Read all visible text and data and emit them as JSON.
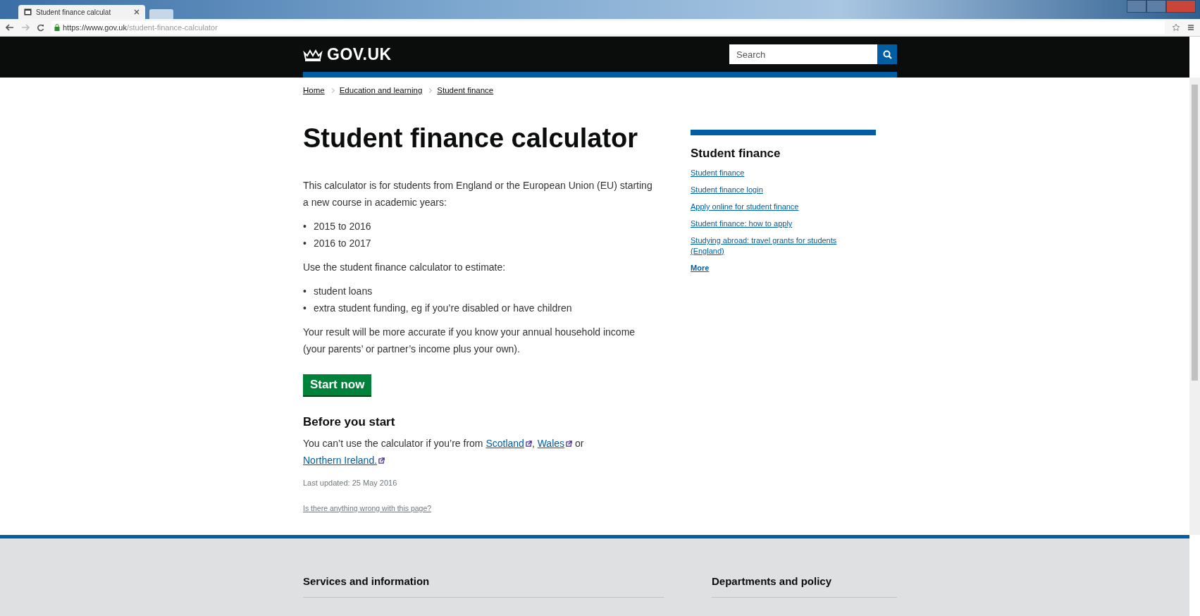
{
  "browser": {
    "tab_title": "Student finance calculat",
    "url_host": "https://www.gov.uk",
    "url_path": "/student-finance-calculator"
  },
  "header": {
    "logo": "GOV.UK",
    "search": {
      "placeholder": "Search"
    }
  },
  "breadcrumbs": [
    "Home",
    "Education and learning",
    "Student finance"
  ],
  "main": {
    "title": "Student finance calculator",
    "blocks": [
      {
        "kind": "para",
        "text": "This calculator is for students from England or the European Union (EU) starting a new course in academic years:"
      },
      {
        "kind": "list",
        "items": [
          {
            "marker": "•",
            "text": "2015 to 2016"
          },
          {
            "marker": "•",
            "text": "2016 to 2017"
          }
        ]
      },
      {
        "kind": "para",
        "text": "Use the student finance calculator to estimate:"
      },
      {
        "kind": "list",
        "items": [
          {
            "marker": "•",
            "text": "student loans"
          },
          {
            "marker": "•",
            "text": "extra student funding, eg if you’re disabled or have children"
          }
        ]
      },
      {
        "kind": "para",
        "text": "Your result will be more accurate if you know your annual household income (your parents’ or partner’s income plus your own)."
      }
    ],
    "start_button": "Start now",
    "before_heading": "Before you start",
    "before_parts": [
      {
        "kind": "text",
        "text": "You can’t use the calculator if you’re from "
      },
      {
        "kind": "link",
        "text": "Scotland"
      },
      {
        "kind": "text",
        "text": ", "
      },
      {
        "kind": "link",
        "text": "Wales"
      },
      {
        "kind": "text",
        "text": " or "
      },
      {
        "kind": "link",
        "text": "Northern Ireland."
      }
    ],
    "last_updated": "Last updated: 25 May 2016",
    "report_link": "Is there anything wrong with this page?"
  },
  "sidebar": {
    "title": "Student finance",
    "links": [
      "Student finance",
      "Student finance login",
      "Apply online for student finance",
      "Student finance: how to apply",
      "Studying abroad: travel grants for students (England)"
    ],
    "more": "More"
  },
  "footer": {
    "headings": [
      "Services and information",
      "Departments and policy"
    ]
  }
}
